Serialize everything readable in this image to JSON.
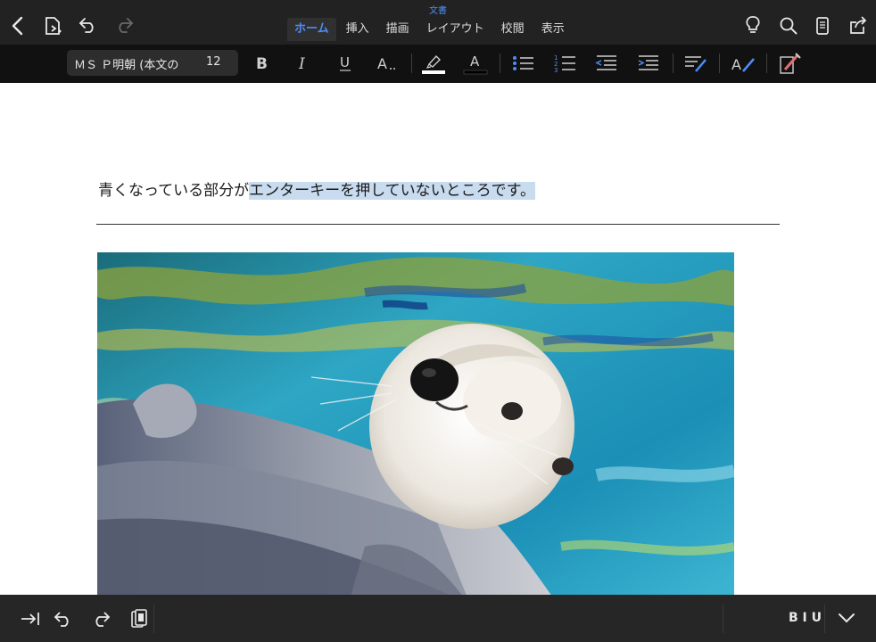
{
  "window": {
    "doc_title": "文書"
  },
  "tabs": [
    {
      "label": "ホーム",
      "active": true
    },
    {
      "label": "挿入"
    },
    {
      "label": "描画"
    },
    {
      "label": "レイアウト"
    },
    {
      "label": "校閲"
    },
    {
      "label": "表示"
    }
  ],
  "ribbon": {
    "font_name": "ＭＳ Ｐ明朝 (本文の",
    "font_size": "12"
  },
  "document": {
    "text_before": "青くなっている部分が",
    "text_highlight": "エンターキーを押していないところです。",
    "image_description": "sea-otter-photo"
  },
  "bottom": {
    "biu_label": "B I U"
  },
  "colors": {
    "accent": "#4c8ef7",
    "highlight": "#c8dbef",
    "topbar": "#222222",
    "ribbon": "#111111"
  },
  "icons": [
    "back-icon",
    "file-icon",
    "undo-icon",
    "redo-icon",
    "lightbulb-icon",
    "search-icon",
    "phone-view-icon",
    "share-icon",
    "bold-icon",
    "italic-icon",
    "underline-icon",
    "text-effects-icon",
    "highlighter-icon",
    "font-color-icon",
    "bullets-icon",
    "numbering-icon",
    "outdent-icon",
    "indent-icon",
    "styles-icon",
    "clear-format-icon",
    "format-painter-icon",
    "tab-icon",
    "paste-icon",
    "collapse-icon"
  ]
}
